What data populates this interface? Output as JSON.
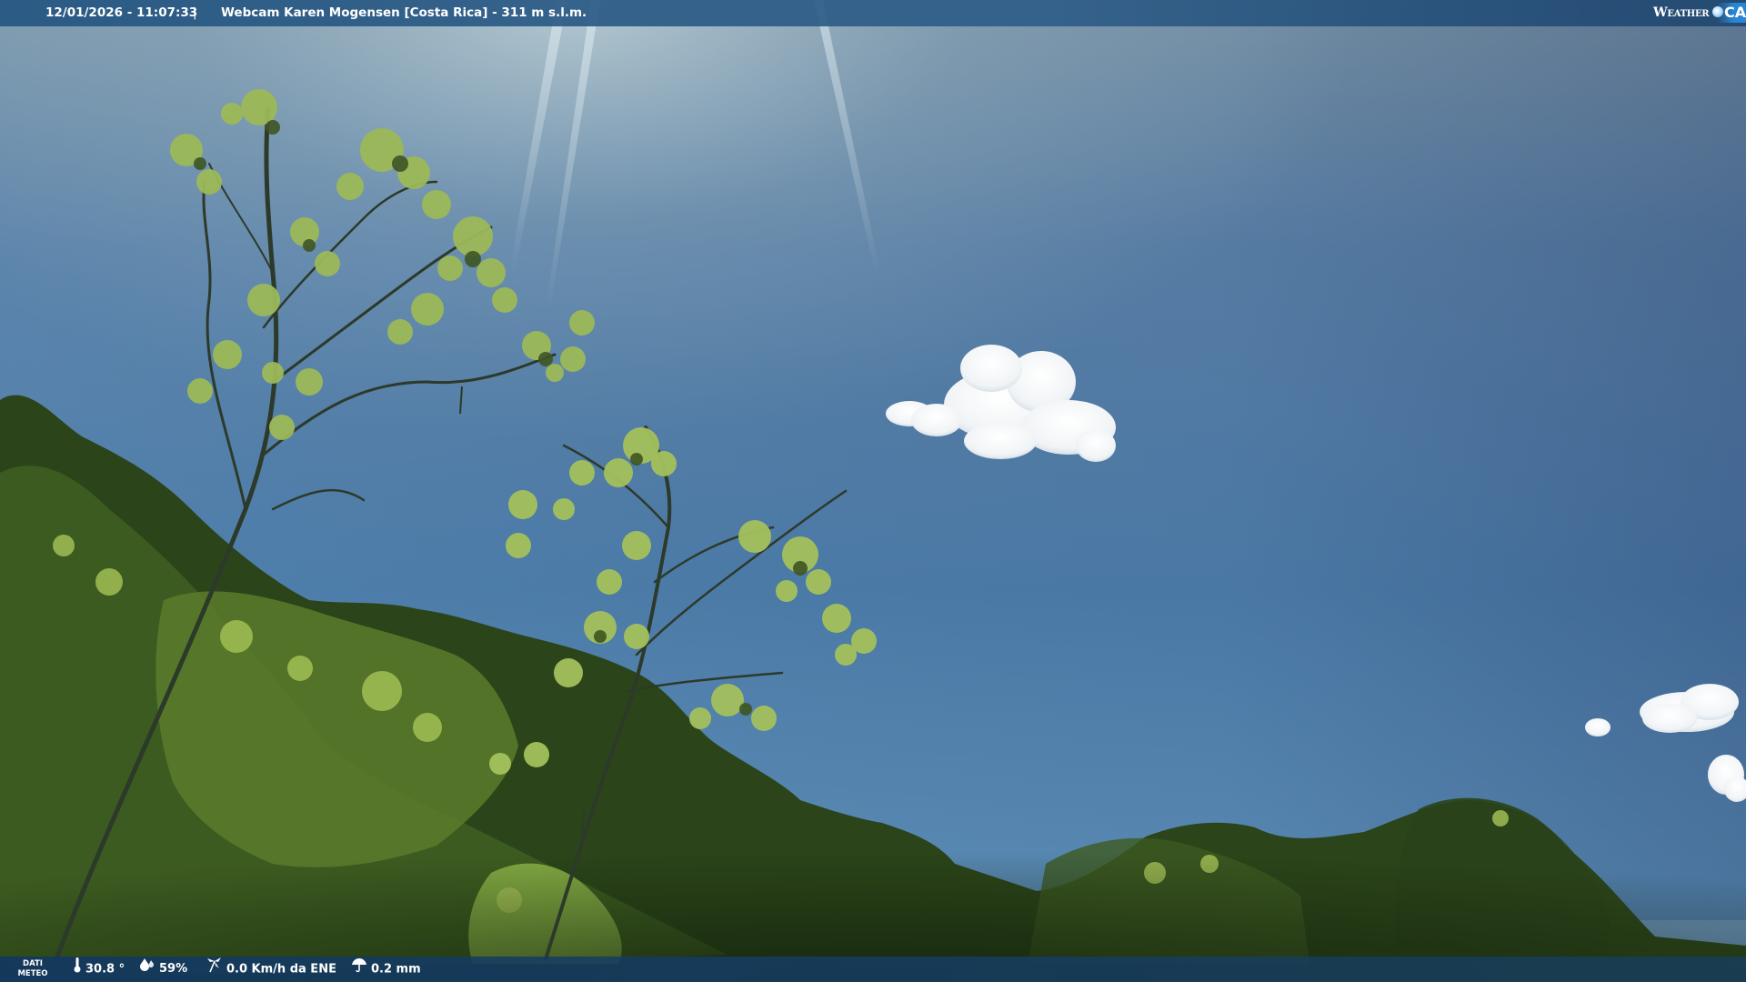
{
  "overlay_top": {
    "datetime": "12/01/2026 - 11:07:33",
    "separator": "|",
    "camera_title": "Webcam Karen Mogensen [Costa Rica]  - 311 m s.l.m.",
    "brand": {
      "weather": "Weather",
      "cam": "CAM",
      "icon": "globe-icon"
    }
  },
  "overlay_bottom": {
    "label_line1": "DATI",
    "label_line2": "METEO",
    "temperature": "30.8 °",
    "humidity": "59%",
    "wind": "0.0 Km/h da ENE",
    "rain": "0.2 mm",
    "icons": {
      "temperature": "thermometer-icon",
      "humidity": "humidity-icon",
      "wind": "wind-icon",
      "rain": "rain-icon"
    }
  },
  "colors": {
    "top_bar": "#2c5a86",
    "bottom_bar": "#163d68",
    "sky_top": "#88a4b5",
    "sky_mid": "#4f7eac",
    "sky_bottom": "#5c93bd",
    "foliage_dark": "#1f3414",
    "foliage_light": "#9dbf52"
  }
}
